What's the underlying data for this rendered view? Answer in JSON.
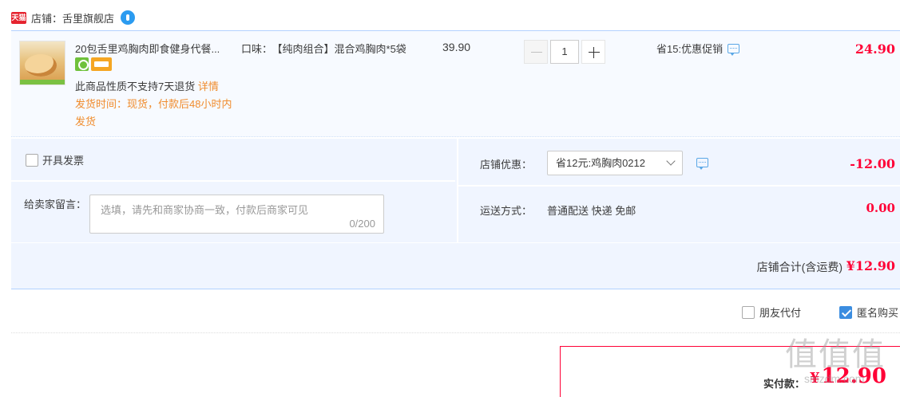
{
  "shop": {
    "tmall_badge": "天猫",
    "label": "店铺：",
    "name": "舌里旗舰店"
  },
  "item": {
    "title": "20包舌里鸡胸肉即食健身代餐...",
    "notice_gray": "此商品性质不支持7天退货",
    "notice_link": "详情",
    "ship_time": "发货时间：现货，付款后48小时内发货",
    "spec_label": "口味：",
    "spec_value": "【纯肉组合】混合鸡胸肉*5袋",
    "unit_price": "39.90",
    "quantity": "1",
    "promo": "省15:优惠促销",
    "total": "24.90"
  },
  "options": {
    "invoice_label": "开具发票",
    "message_label": "给卖家留言：",
    "message_placeholder": "选填，请先和商家协商一致，付款后商家可见",
    "message_count": "0/200",
    "discount_label": "店铺优惠：",
    "discount_value": "省12元:鸡胸肉0212",
    "discount_amount": "-12.00",
    "shipping_label": "运送方式：",
    "shipping_value": "普通配送 快递 免邮",
    "shipping_amount": "0.00"
  },
  "subtotal": {
    "label": "店铺合计(含运费)",
    "amount": "¥12.90"
  },
  "extras": {
    "friend_pay": "朋友代付",
    "anonymous": "匿名购买",
    "anonymous_checked": true
  },
  "payment": {
    "label": "实付款：",
    "currency": "¥",
    "amount": "12.90"
  },
  "watermark": {
    "glyphs": "值值值",
    "url": "smzdm.com"
  },
  "colors": {
    "accent_red": "#ff0036",
    "border_blue": "#b2d1ff",
    "panel_bg": "#f0f5ff",
    "link_orange": "#f08c2d"
  }
}
